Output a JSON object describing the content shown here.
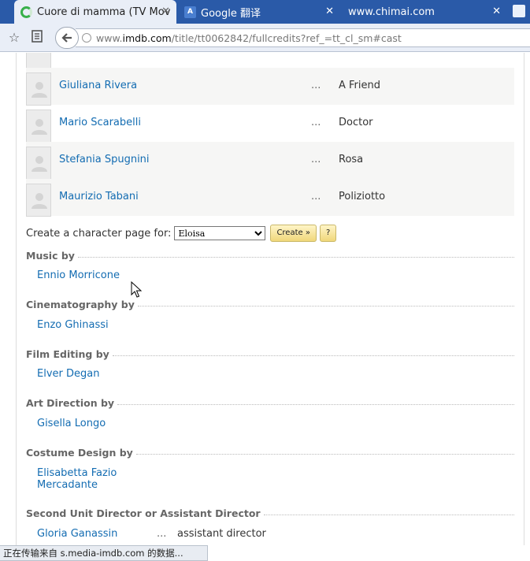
{
  "browser": {
    "tabs": [
      {
        "title": "Cuore di mamma (TV Mov",
        "active": true,
        "icon": "loading-spinner-icon"
      },
      {
        "title": "Google 翻译",
        "active": false,
        "icon": "google-translate-icon"
      },
      {
        "title": "www.chimai.com",
        "active": false,
        "icon": ""
      }
    ],
    "close_glyph": "✕",
    "url": {
      "host_prefix": "www.",
      "host_main": "imdb.com",
      "path": "/title/tt0062842/fullcredits?ref_=tt_cl_sm#cast"
    }
  },
  "cast": [
    {
      "name": "Giuliana Rivera",
      "ellipsis": "...",
      "character": "A Friend"
    },
    {
      "name": "Mario Scarabelli",
      "ellipsis": "...",
      "character": "Doctor"
    },
    {
      "name": "Stefania Spugnini",
      "ellipsis": "...",
      "character": "Rosa"
    },
    {
      "name": "Maurizio Tabani",
      "ellipsis": "...",
      "character": "Poliziotto"
    }
  ],
  "character_page": {
    "label": "Create a character page for:",
    "selected": "Eloisa",
    "create_label": "Create »",
    "help_label": "?"
  },
  "sections": [
    {
      "heading": "Music by",
      "credits": [
        "Ennio Morricone"
      ]
    },
    {
      "heading": "Cinematography by",
      "credits": [
        "Enzo Ghinassi"
      ]
    },
    {
      "heading": "Film Editing by",
      "credits": [
        "Elver Degan"
      ]
    },
    {
      "heading": "Art Direction by",
      "credits": [
        "Gisella Longo"
      ]
    },
    {
      "heading": "Costume Design by",
      "credits": [
        "Elisabetta Fazio Mercadante"
      ]
    },
    {
      "heading": "Second Unit Director or Assistant Director",
      "credits": [
        {
          "name": "Gloria Ganassin",
          "ellipsis": "...",
          "role": "assistant director"
        }
      ]
    }
  ],
  "costume_lines": [
    "Elisabetta Fazio",
    "Mercadante"
  ],
  "status": "正在传输来自 s.media-imdb.com 的数据..."
}
